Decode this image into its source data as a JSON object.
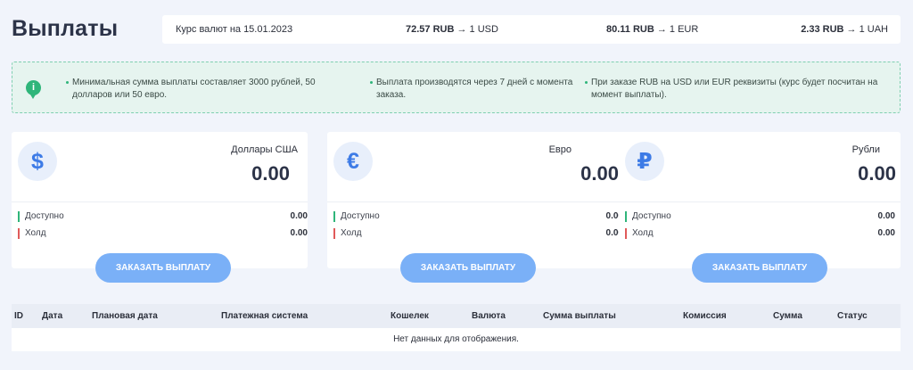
{
  "page": {
    "title": "Выплаты"
  },
  "rates": {
    "date_label": "Курс валют на 15.01.2023",
    "items": [
      {
        "value": "72.57 RUB",
        "target": " → 1 USD"
      },
      {
        "value": "80.11 RUB",
        "target": " → 1 EUR"
      },
      {
        "value": "2.33 RUB",
        "target": " → 1 UAH"
      }
    ]
  },
  "notice": {
    "icon": "info-icon",
    "items": [
      "Минимальная сумма выплаты составляет 3000 рублей, 50 долларов или 50 евро.",
      "Выплата производятся через 7 дней с момента заказа.",
      "При заказе RUB на USD или EUR реквизиты (курс будет посчитан на момент выплаты)."
    ]
  },
  "cards": [
    {
      "icon": "dollar-icon",
      "symbol": "$",
      "name": "Доллары США",
      "total": "0.00",
      "available_label": "Доступно",
      "available": "0.00",
      "hold_label": "Холд",
      "hold": "0.00",
      "button": "ЗАКАЗАТЬ ВЫПЛАТУ"
    },
    {
      "icon": "euro-icon",
      "symbol": "€",
      "name": "Евро",
      "total": "0.00",
      "available_label": "Доступно",
      "available": "0.00",
      "hold_label": "Холд",
      "hold": "0.00",
      "button": "ЗАКАЗАТЬ ВЫПЛАТУ"
    },
    {
      "icon": "ruble-icon",
      "symbol": "₽",
      "name": "Рубли",
      "total": "0.00",
      "available_label": "Доступно",
      "available": "0.00",
      "hold_label": "Холд",
      "hold": "0.00",
      "button": "ЗАКАЗАТЬ ВЫПЛАТУ"
    }
  ],
  "table": {
    "columns": [
      "ID",
      "Дата",
      "Плановая дата",
      "Платежная система",
      "Кошелек",
      "Валюта",
      "Сумма выплаты",
      "Комиссия",
      "Сумма",
      "Статус"
    ],
    "empty_text": "Нет данных для отображения."
  },
  "colors": {
    "accent": "#7ab0f7",
    "success": "#2fb57a",
    "danger": "#e05a5a",
    "background": "#f1f4fb"
  }
}
